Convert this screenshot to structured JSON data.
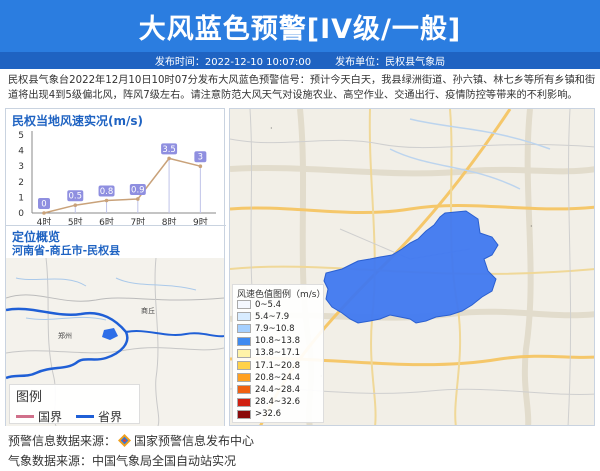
{
  "header": {
    "title": "大风蓝色预警[IV级/一般]",
    "publish_time": "发布时间：2022-12-10 10:07:00",
    "publish_unit": "发布单位：民权县气象局"
  },
  "description": "民权县气象台2022年12月10日10时07分发布大风蓝色预警信号：预计今天白天，我县绿洲街道、孙六镇、林七乡等所有乡镇和街道将出现4到5级偏北风，阵风7级左右。请注意防范大风天气对设施农业、高空作业、交通出行、疫情防控等带来的不利影响。",
  "wind_panel": {
    "title": "民权当地风速实况(m/s)"
  },
  "chart_data": {
    "type": "line",
    "categories": [
      "4时",
      "5时",
      "6时",
      "7时",
      "8时",
      "9时"
    ],
    "values": [
      0,
      0.5,
      0.8,
      0.9,
      3.5,
      3
    ],
    "value_labels": [
      "0",
      "0.5",
      "0.8",
      "0.9",
      "3.5",
      "3"
    ],
    "yticks": [
      "0",
      "1",
      "2",
      "3",
      "4",
      "5"
    ],
    "ylim": [
      0,
      5
    ],
    "line_color": "#c9a27a",
    "label_color": "#8f8fe0"
  },
  "location_panel": {
    "title": "定位概览",
    "region": "河南省-商丘市-民权县",
    "legend_title": "图例",
    "legend_items": [
      {
        "label": "国界",
        "color": "#d0708a"
      },
      {
        "label": "省界",
        "color": "#1f5fd6"
      }
    ]
  },
  "map": {
    "legend_title": "风速色值图例（m/s）",
    "legend_items": [
      {
        "label": "0~5.4",
        "color": "#f4f8ff"
      },
      {
        "label": "5.4~7.9",
        "color": "#d8ecff"
      },
      {
        "label": "7.9~10.8",
        "color": "#a6d0ff"
      },
      {
        "label": "10.8~13.8",
        "color": "#3f8af0"
      },
      {
        "label": "13.8~17.1",
        "color": "#fff3a8"
      },
      {
        "label": "17.1~20.8",
        "color": "#ffd24a"
      },
      {
        "label": "20.8~24.4",
        "color": "#ffa020"
      },
      {
        "label": "24.4~28.4",
        "color": "#f06010"
      },
      {
        "label": "28.4~32.6",
        "color": "#d02010"
      },
      {
        "label": ">32.6",
        "color": "#8a0a0a"
      }
    ],
    "region_color": "#3f78f0"
  },
  "footer": {
    "line1_prefix": "预警信息数据来源：",
    "line1_source": "国家预警信息发布中心",
    "line2": "气象数据来源：中国气象局全国自动站实况"
  }
}
